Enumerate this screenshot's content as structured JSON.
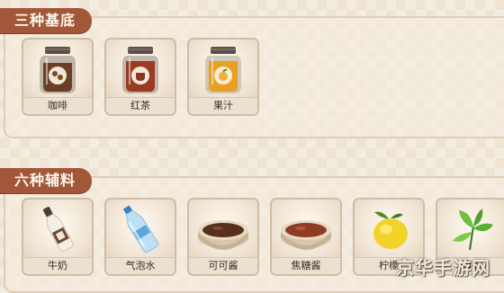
{
  "sections": {
    "base": {
      "title": "三种基底"
    },
    "toppings": {
      "title": "六种辅料"
    }
  },
  "base_items": [
    {
      "label": "咖啡",
      "icon": "coffee-jar-icon"
    },
    {
      "label": "红茶",
      "icon": "black-tea-jar-icon"
    },
    {
      "label": "果汁",
      "icon": "juice-jar-icon"
    }
  ],
  "topping_items": [
    {
      "label": "牛奶",
      "icon": "milk-bottle-icon"
    },
    {
      "label": "气泡水",
      "icon": "sparkling-water-bottle-icon"
    },
    {
      "label": "可可酱",
      "icon": "cocoa-sauce-bowl-icon"
    },
    {
      "label": "焦糖酱",
      "icon": "caramel-sauce-bowl-icon"
    },
    {
      "label": "柠檬",
      "icon": "lemon-icon"
    },
    {
      "label": "薄荷",
      "icon": "mint-icon"
    }
  ],
  "watermark": "京华手游网",
  "colors": {
    "tab": "#a2573a",
    "background": "#efe4d4",
    "card": "#f9f3ea"
  }
}
